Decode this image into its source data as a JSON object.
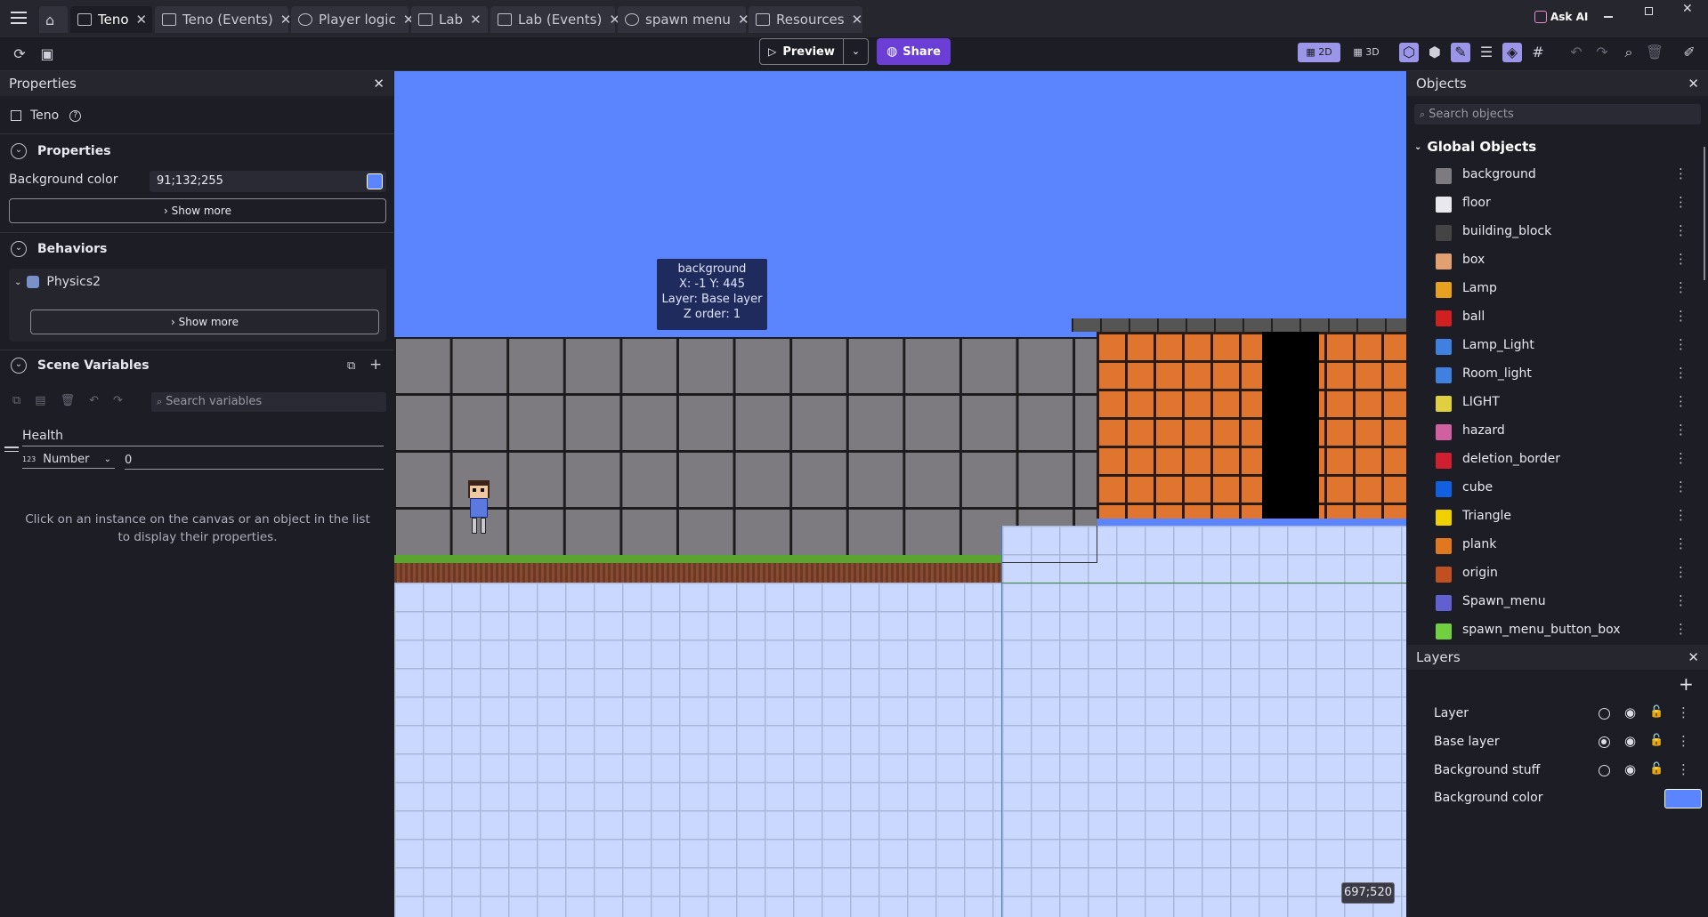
{
  "tabs": [
    {
      "label": "Teno",
      "active": true
    },
    {
      "label": "Teno (Events)"
    },
    {
      "label": "Player logic"
    },
    {
      "label": "Lab"
    },
    {
      "label": "Lab (Events)"
    },
    {
      "label": "spawn menu"
    },
    {
      "label": "Resources"
    }
  ],
  "topbar": {
    "ask_ai": "Ask AI"
  },
  "toolbar": {
    "preview_label": "Preview",
    "share_label": "Share",
    "mode_2d": "2D",
    "mode_3d": "3D"
  },
  "properties": {
    "panel_title": "Properties",
    "scene_name": "Teno",
    "section_properties": "Properties",
    "bg_color_label": "Background color",
    "bg_color_value": "91;132;255",
    "show_more": "Show more",
    "section_behaviors": "Behaviors",
    "behavior_name": "Physics2",
    "behaviors_show_more": "Show more",
    "section_scene_vars": "Scene Variables",
    "search_vars_placeholder": "Search variables",
    "variable_name": "Health",
    "variable_type": "Number",
    "variable_value": "0",
    "hint": "Click on an instance on the canvas or an object in the list to display their properties.",
    "colors": {
      "bg_swatch": "#5b84ff"
    }
  },
  "canvas": {
    "tooltip": {
      "line1": "background",
      "line2": "X: -1  Y: 445",
      "line3": "Layer: Base layer",
      "line4": "Z order: 1"
    },
    "coords": "697;520"
  },
  "objects": {
    "panel_title": "Objects",
    "search_placeholder": "Search objects",
    "group_title": "Global Objects",
    "items": [
      {
        "name": "background",
        "color": "#7d7a80"
      },
      {
        "name": "floor",
        "color": "#e8e8ee"
      },
      {
        "name": "building_block",
        "color": "#444444"
      },
      {
        "name": "box",
        "color": "#e0a070"
      },
      {
        "name": "Lamp",
        "color": "#e8a020"
      },
      {
        "name": "ball",
        "color": "#d02020"
      },
      {
        "name": "Lamp_Light",
        "color": "#4080e0"
      },
      {
        "name": "Room_light",
        "color": "#4080e0"
      },
      {
        "name": "LIGHT",
        "color": "#e0d040"
      },
      {
        "name": "hazard",
        "color": "#d060a0"
      },
      {
        "name": "deletion_border",
        "color": "#d02030"
      },
      {
        "name": "cube",
        "color": "#1060e0"
      },
      {
        "name": "Triangle",
        "color": "#f0d000"
      },
      {
        "name": "plank",
        "color": "#e07820"
      },
      {
        "name": "origin",
        "color": "#c05020"
      },
      {
        "name": "Spawn_menu",
        "color": "#6060d0"
      },
      {
        "name": "spawn_menu_button_box",
        "color": "#70d040"
      }
    ]
  },
  "layers": {
    "panel_title": "Layers",
    "items": [
      {
        "name": "Layer",
        "selected": false
      },
      {
        "name": "Base layer",
        "selected": true
      },
      {
        "name": "Background stuff",
        "selected": false
      }
    ],
    "bg_color_label": "Background color",
    "bg_swatch": "#5b84ff"
  }
}
